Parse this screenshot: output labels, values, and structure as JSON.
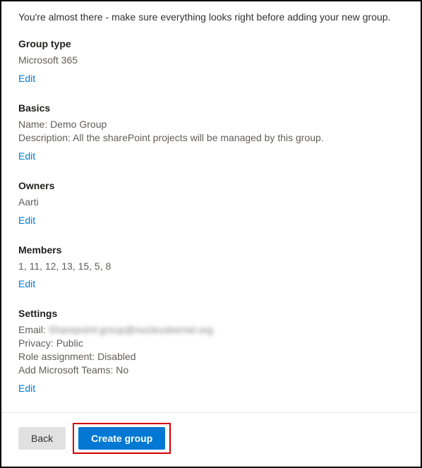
{
  "intro": "You're almost there - make sure everything looks right before adding your new group.",
  "edit_label": "Edit",
  "groupType": {
    "title": "Group type",
    "value": "Microsoft 365"
  },
  "basics": {
    "title": "Basics",
    "name_label": "Name:",
    "name_value": "Demo Group",
    "desc_label": "Description:",
    "desc_value": "All the sharePoint projects will be managed by this group."
  },
  "owners": {
    "title": "Owners",
    "value": "Aarti"
  },
  "members": {
    "title": "Members",
    "value": "1, 11, 12, 13, 15, 5, 8"
  },
  "settings": {
    "title": "Settings",
    "email_label": "Email:",
    "email_value": "Sharepoint-group@nucleuskernel.org",
    "privacy_label": "Privacy:",
    "privacy_value": "Public",
    "role_label": "Role assignment:",
    "role_value": "Disabled",
    "teams_label": "Add Microsoft Teams:",
    "teams_value": "No"
  },
  "footer": {
    "back": "Back",
    "create": "Create group"
  }
}
